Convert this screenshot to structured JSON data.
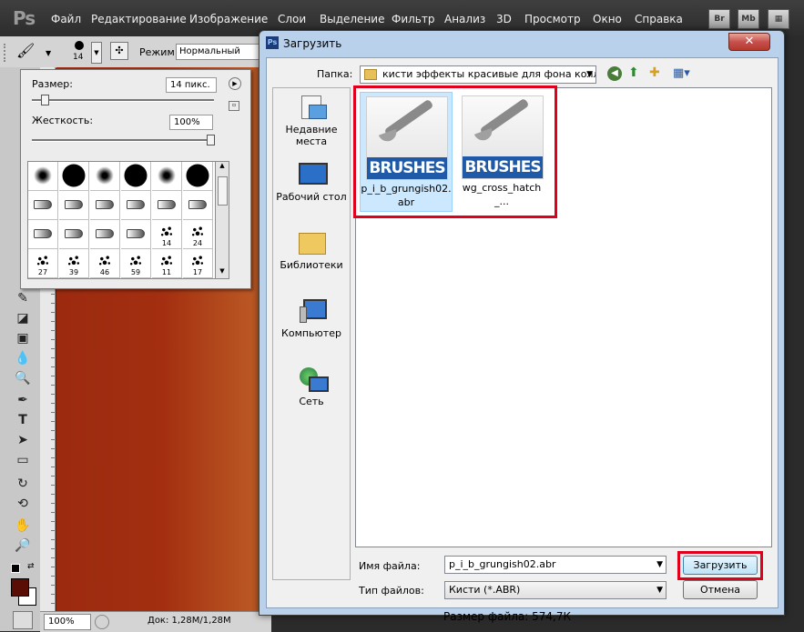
{
  "app": {
    "logo": "Ps",
    "menu": [
      "Файл",
      "Редактирование",
      "Изображение",
      "Слои",
      "Выделение",
      "Фильтр",
      "Анализ",
      "3D",
      "Просмотр",
      "Окно",
      "Справка"
    ],
    "right_buttons": [
      "Br",
      "Mb"
    ]
  },
  "options_bar": {
    "brush_size": "14",
    "mode_label": "Режим:",
    "mode_value": "Нормальный"
  },
  "brush_picker": {
    "size_label": "Размер:",
    "size_value": "14 пикс.",
    "hardness_label": "Жесткость:",
    "hardness_value": "100%",
    "size_fraction": 0.05,
    "hardness_fraction": 1.0,
    "presets": [
      {
        "kind": "soft",
        "num": ""
      },
      {
        "kind": "hard",
        "num": ""
      },
      {
        "kind": "soft",
        "num": ""
      },
      {
        "kind": "hard",
        "num": ""
      },
      {
        "kind": "soft",
        "num": ""
      },
      {
        "kind": "hard",
        "num": ""
      },
      {
        "kind": "tip",
        "num": ""
      },
      {
        "kind": "tip",
        "num": ""
      },
      {
        "kind": "tip",
        "num": ""
      },
      {
        "kind": "tip",
        "num": ""
      },
      {
        "kind": "tip",
        "num": ""
      },
      {
        "kind": "tip",
        "num": ""
      },
      {
        "kind": "tip",
        "num": ""
      },
      {
        "kind": "tip",
        "num": ""
      },
      {
        "kind": "tip",
        "num": ""
      },
      {
        "kind": "tip",
        "num": ""
      },
      {
        "kind": "splat",
        "num": "14"
      },
      {
        "kind": "splat",
        "num": "24"
      },
      {
        "kind": "splat",
        "num": "27"
      },
      {
        "kind": "splat",
        "num": "39"
      },
      {
        "kind": "splat",
        "num": "46"
      },
      {
        "kind": "splat",
        "num": "59"
      },
      {
        "kind": "splat",
        "num": "11"
      },
      {
        "kind": "splat",
        "num": "17"
      }
    ]
  },
  "status": {
    "zoom": "100%",
    "doc": "Док: 1,28M/1,28M"
  },
  "dialog": {
    "title": "Загрузить",
    "folder_label": "Папка:",
    "folder_value": "кисти эффекты красивые для фона колла",
    "places": [
      "Недавние места",
      "Рабочий стол",
      "Библиотеки",
      "Компьютер",
      "Сеть"
    ],
    "files": [
      {
        "name": "p_i_b_grungish02.abr",
        "banner": "BRUSHES",
        "selected": true
      },
      {
        "name": "wg_cross_hatch_...",
        "banner": "BRUSHES",
        "selected": false
      }
    ],
    "filename_label": "Имя файла:",
    "filename_value": "p_i_b_grungish02.abr",
    "filetype_label": "Тип файлов:",
    "filetype_value": "Кисти (*.ABR)",
    "load_button": "Загрузить",
    "cancel_button": "Отмена",
    "filesize": "Размер файла: 574,7К"
  },
  "colors": {
    "accent_highlight": "#e0001b",
    "foreground_swatch": "#5a0d05",
    "brush_banner": "#1f5aa8"
  }
}
